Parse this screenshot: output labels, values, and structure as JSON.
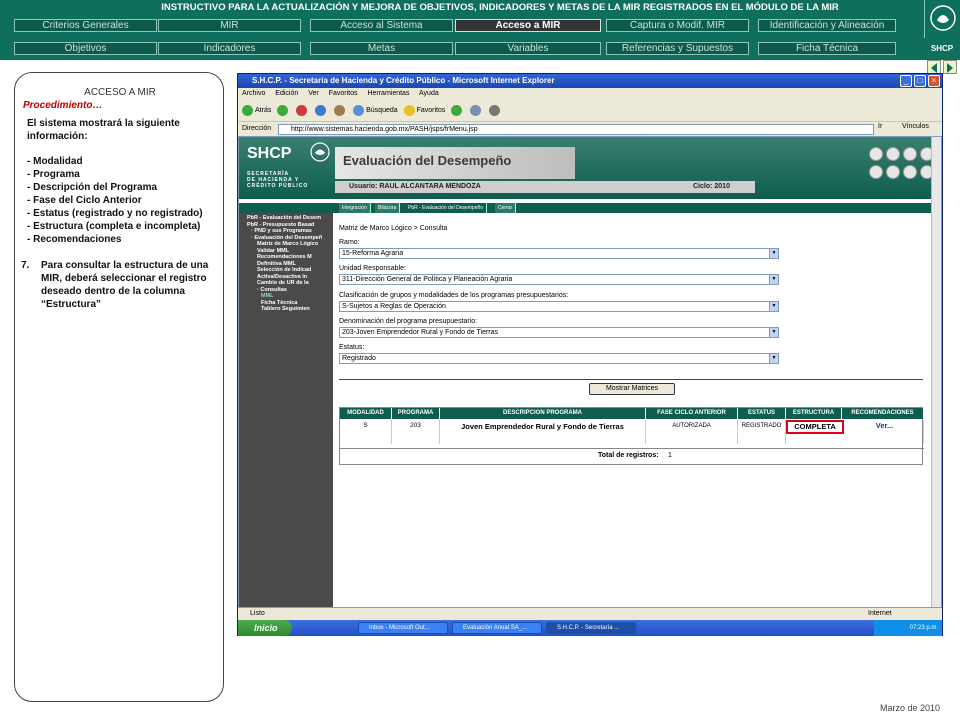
{
  "header": {
    "title": "INSTRUCTIVO PARA LA ACTUALIZACIÓN Y MEJORA DE OBJETIVOS, INDICADORES Y METAS DE LA MIR REGISTRADOS EN EL MÓDULO DE LA MIR",
    "nav_row1": [
      "Criterios Generales",
      "MIR",
      "Acceso al Sistema",
      "Acceso a MIR",
      "Captura o Modif. MIR",
      "Identificación y Alineación"
    ],
    "nav_row2": [
      "Objetivos",
      "Indicadores",
      "Metas",
      "Variables",
      "Referencias y Supuestos",
      "Ficha Técnica"
    ],
    "active_tab": "Acceso a MIR",
    "brand_tag": "SHCP"
  },
  "left_panel": {
    "title": "ACCESO A MIR",
    "subtitle": "Procedimiento…",
    "intro": "El sistema mostrará la siguiente información:",
    "items": [
      "- Modalidad",
      "- Programa",
      "- Descripción del Programa",
      "- Fase del Ciclo Anterior",
      "- Estatus (registrado y no registrado)",
      "- Estructura (completa e incompleta)",
      "- Recomendaciones"
    ],
    "step_number": "7.",
    "step_text": "Para consultar la estructura de una MIR, deberá seleccionar el registro deseado dentro de la columna “Estructura”"
  },
  "footer": {
    "date": "Marzo de 2010"
  },
  "browser": {
    "title": "S.H.C.P. - Secretaría de Hacienda y Crédito Público - Microsoft Internet Explorer",
    "menu": [
      "Archivo",
      "Edición",
      "Ver",
      "Favoritos",
      "Herramientas",
      "Ayuda"
    ],
    "toolbar": {
      "back": "Atrás",
      "search": "Búsqueda",
      "favorites": "Favoritos"
    },
    "address_label": "Dirección",
    "url": "http://www.sistemas.hacienda.gob.mx/PASH/jsps/frMenu.jsp",
    "go": "Ir",
    "links": "Vínculos",
    "status": "Listo",
    "zone": "Internet"
  },
  "app": {
    "logo": "SHCP",
    "logo_sub": [
      "SECRETARÍA",
      "DE HACIENDA Y",
      "CRÉDITO PÚBLICO"
    ],
    "heading": "Evaluación del Desempeño",
    "user": "Usuario: RAUL ALCANTARA MENDOZA",
    "ciclo": "Ciclo: 2010",
    "tabs": [
      "Integración",
      "Bitácora",
      "PbR - Evaluación del Desempeño",
      "Cerrar"
    ],
    "side_menu": [
      "PbR - Evaluación del Desem",
      "PbR - Presupuesto Basad",
      "· PND y sus Programas",
      "· Evaluación del Desempeñ",
      "Matriz de Marco Lógico",
      "Validar MML",
      "Recomendaciones M",
      "Definitiva MML",
      "Selección de Indicad",
      "Activa/Desactiva In",
      "Cambio de UR de la",
      "· Consultas",
      "MML",
      "Ficha Técnica",
      "Tablero Seguimien"
    ],
    "breadcrumb": "Matriz de Marco Lógico > Consulta",
    "fields": [
      {
        "label": "Ramo:",
        "value": "15-Reforma Agraria"
      },
      {
        "label": "Unidad Responsable:",
        "value": "311-Dirección General de Política y Planeación Agraria"
      },
      {
        "label": "Clasificación de grupos y modalidades de los programas presupuestarios:",
        "value": "S-Sujetos a Reglas de Operación"
      },
      {
        "label": "Denominación del programa presupuestario:",
        "value": "203-Joven Emprendedor Rural y Fondo de Tierras"
      },
      {
        "label": "Estatus:",
        "value": "Registrado"
      }
    ],
    "show_button": "Mostrar Matrices",
    "table_headers": [
      "MODALIDAD",
      "PROGRAMA",
      "DESCRIPCION PROGRAMA",
      "FASE CICLO ANTERIOR",
      "ESTATUS",
      "ESTRUCTURA",
      "RECOMENDACIONES"
    ],
    "table_row": [
      "S",
      "203",
      "Joven Emprendedor Rural y Fondo de Tierras",
      "AUTORIZADA",
      "REGISTRADO",
      "COMPLETA",
      "Ver..."
    ],
    "total_label": "Total de registros:",
    "total_value": "1"
  },
  "taskbar": {
    "start": "Inicio",
    "tasks": [
      "Inbox - Microsoft Out...",
      "Evaluación Anual SA_...",
      "S.H.C.P. - Secretaría ..."
    ],
    "clock": "07:23 p.m."
  },
  "colors": {
    "header_green": "#0e6f5c",
    "highlight_red": "#e0001b"
  }
}
